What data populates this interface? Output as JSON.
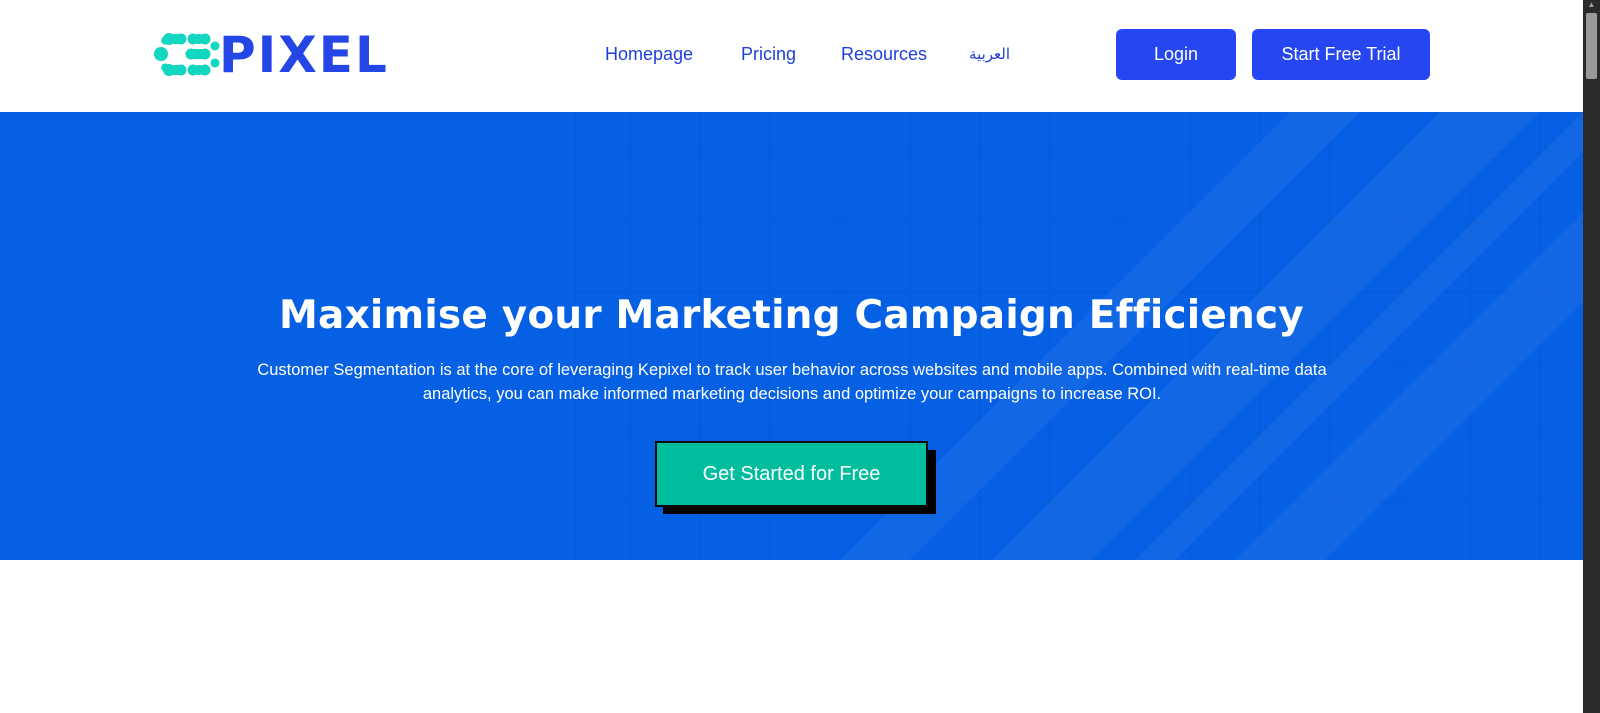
{
  "header": {
    "logo_text": "PIXEL",
    "nav": [
      {
        "label": "Homepage"
      },
      {
        "label": "Pricing"
      },
      {
        "label": "Resources"
      },
      {
        "label": "العربية"
      }
    ],
    "login_label": "Login",
    "trial_label": "Start Free Trial"
  },
  "hero": {
    "title": "Maximise your Marketing Campaign Efficiency",
    "description": "Customer Segmentation is at the core of leveraging Kepixel to track user behavior across websites and mobile apps. Combined with real-time data analytics, you can make informed marketing decisions and optimize your campaigns to increase ROI.",
    "cta_label": "Get Started for Free"
  },
  "colors": {
    "brand_blue": "#2546f0",
    "hero_blue": "#0560e3",
    "logo_teal": "#12d6c0",
    "cta_green": "#00bd9d"
  },
  "scrollbar": {
    "up_arrow_icon": "▲"
  }
}
